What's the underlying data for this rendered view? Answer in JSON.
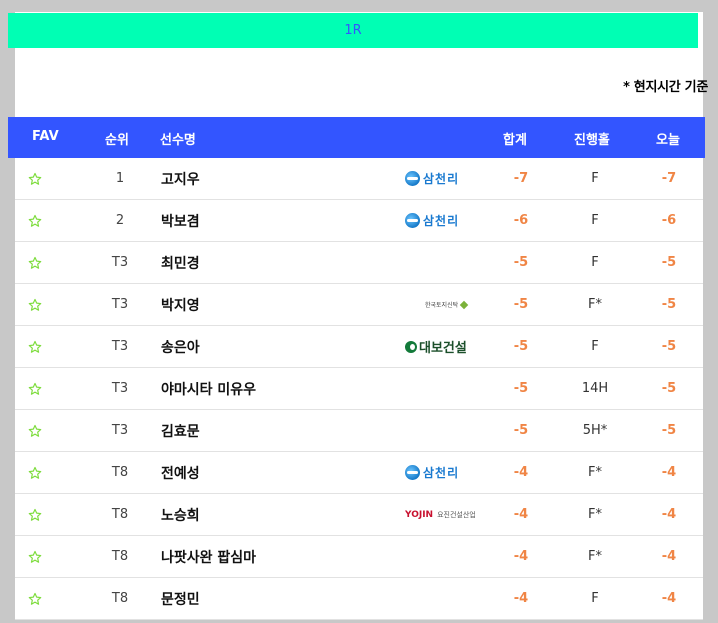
{
  "round": {
    "label": "1R"
  },
  "time_note": "* 현지시간 기준",
  "header": {
    "fav": "FAV",
    "rank": "순위",
    "name": "선수명",
    "total": "합계",
    "thru": "진행홀",
    "today": "오늘"
  },
  "colors": {
    "accent_green": "#00ffb4",
    "header_blue": "#3355ff",
    "score_orange": "#f08545",
    "star_green": "#7ddc3c"
  },
  "sponsors": {
    "samchully": "삼천리",
    "hankook_trust": "한국토지신탁",
    "daebo": "대보건설",
    "yojin_brand": "YOJIN",
    "yojin_sub": "요진건설산업"
  },
  "rows": [
    {
      "rank": "1",
      "name": "고지우",
      "sponsor": "samchully",
      "total": "-7",
      "thru": "F",
      "today": "-7"
    },
    {
      "rank": "2",
      "name": "박보겸",
      "sponsor": "samchully",
      "total": "-6",
      "thru": "F",
      "today": "-6"
    },
    {
      "rank": "T3",
      "name": "최민경",
      "sponsor": "",
      "total": "-5",
      "thru": "F",
      "today": "-5"
    },
    {
      "rank": "T3",
      "name": "박지영",
      "sponsor": "hankook_trust",
      "total": "-5",
      "thru": "F*",
      "today": "-5"
    },
    {
      "rank": "T3",
      "name": "송은아",
      "sponsor": "daebo",
      "total": "-5",
      "thru": "F",
      "today": "-5"
    },
    {
      "rank": "T3",
      "name": "야마시타 미유우",
      "sponsor": "",
      "total": "-5",
      "thru": "14H",
      "today": "-5"
    },
    {
      "rank": "T3",
      "name": "김효문",
      "sponsor": "",
      "total": "-5",
      "thru": "5H*",
      "today": "-5"
    },
    {
      "rank": "T8",
      "name": "전예성",
      "sponsor": "samchully",
      "total": "-4",
      "thru": "F*",
      "today": "-4"
    },
    {
      "rank": "T8",
      "name": "노승희",
      "sponsor": "yojin",
      "total": "-4",
      "thru": "F*",
      "today": "-4"
    },
    {
      "rank": "T8",
      "name": "나팟사완 팝심마",
      "sponsor": "",
      "total": "-4",
      "thru": "F*",
      "today": "-4"
    },
    {
      "rank": "T8",
      "name": "문정민",
      "sponsor": "",
      "total": "-4",
      "thru": "F",
      "today": "-4"
    }
  ]
}
